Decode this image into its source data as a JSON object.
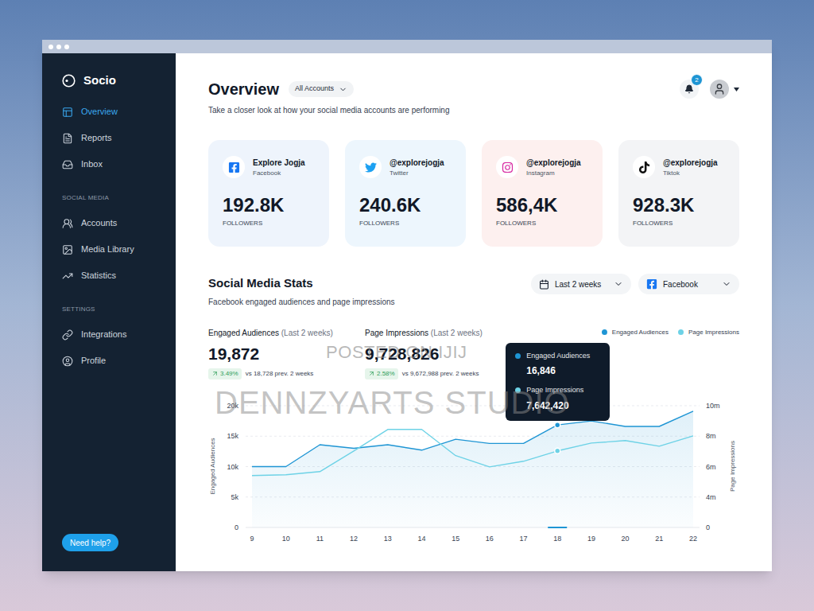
{
  "watermark": [
    "POSTED ON IJIJ",
    "DENNZYARTS STUDIO"
  ],
  "sidebar": {
    "brand": "Socio",
    "items": [
      {
        "label": "Overview",
        "selected": true
      },
      {
        "label": "Reports",
        "selected": false
      },
      {
        "label": "Inbox",
        "selected": false
      }
    ],
    "sections": [
      {
        "heading": "SOCIAL MEDIA",
        "items": [
          {
            "label": "Accounts",
            "selected": false
          },
          {
            "label": "Media Library",
            "selected": false
          },
          {
            "label": "Statistics",
            "selected": false
          }
        ]
      },
      {
        "heading": "SETTINGS",
        "items": [
          {
            "label": "Integrations",
            "selected": false
          },
          {
            "label": "Profile",
            "selected": false
          }
        ]
      }
    ],
    "help_button": "Need help?"
  },
  "header": {
    "title": "Overview",
    "account_filter": "All Accounts",
    "subtitle": "Take a closer look at how your social media accounts are performing",
    "notifications": "2"
  },
  "accounts": [
    {
      "name": "Explore Jogja",
      "platform": "Facebook",
      "followers": "192.8K",
      "unit": "FOLLOWERS",
      "color": "#eef4fc"
    },
    {
      "name": "@explorejogja",
      "platform": "Twitter",
      "followers": "240.6K",
      "unit": "FOLLOWERS",
      "color": "#edf6fd"
    },
    {
      "name": "@explorejogja",
      "platform": "Instagram",
      "followers": "586,4K",
      "unit": "FOLLOWERS",
      "color": "#fdf0ef"
    },
    {
      "name": "@explorejogja",
      "platform": "Tiktok",
      "followers": "928.3K",
      "unit": "FOLLOWERS",
      "color": "#f3f4f6"
    }
  ],
  "stats": {
    "title": "Social Media Stats",
    "subtitle": "Facebook engaged audiences and page impressions",
    "period": "Last 2 weeks",
    "platform": "Facebook",
    "metrics": [
      {
        "label": "Engaged Audiences",
        "period": "(Last 2 weeks)",
        "value": "19,872",
        "change": "3.49%",
        "comparison": "vs 18,728 prev. 2 weeks"
      },
      {
        "label": "Page Impressions",
        "period": "(Last 2 weeks)",
        "value": "9,728,826",
        "change": "2.58%",
        "comparison": "vs 9,672,988 prev. 2 weeks"
      }
    ]
  },
  "chart": {
    "series": [
      {
        "name": "Engaged Audiences",
        "color": "#1e95d4",
        "axis": "left",
        "values": [
          10000,
          10000,
          13600,
          13000,
          13600,
          12700,
          14500,
          13800,
          13800,
          16846,
          17500,
          16600,
          16600,
          19100
        ]
      },
      {
        "name": "Page Impressions",
        "color": "#6dd2e6",
        "axis": "right",
        "values": [
          5410000,
          5460000,
          5670000,
          7030000,
          8440000,
          8440000,
          6720000,
          5980000,
          6350000,
          7030000,
          7550000,
          7710000,
          7340000,
          8020000
        ]
      }
    ],
    "left_axis": {
      "title": "Engaged Audiences",
      "ticks": [
        {
          "label": "0",
          "value": 0
        },
        {
          "label": "5k",
          "value": 5000
        },
        {
          "label": "10k",
          "value": 10000
        },
        {
          "label": "15k",
          "value": 15000
        },
        {
          "label": "20k",
          "value": 20000
        }
      ]
    },
    "right_axis": {
      "title": "Page Impressions",
      "ticks": [
        {
          "label": "0",
          "value": 0
        },
        {
          "label": "4m",
          "value": 4000000
        },
        {
          "label": "6m",
          "value": 6000000
        },
        {
          "label": "8m",
          "value": 8000000
        },
        {
          "label": "10m",
          "value": 10000000
        }
      ]
    },
    "x_ticks": [
      {
        "label": "9",
        "selected": false
      },
      {
        "label": "10",
        "selected": false
      },
      {
        "label": "11",
        "selected": false
      },
      {
        "label": "12",
        "selected": false
      },
      {
        "label": "13",
        "selected": false
      },
      {
        "label": "14",
        "selected": false
      },
      {
        "label": "15",
        "selected": false
      },
      {
        "label": "16",
        "selected": false
      },
      {
        "label": "17",
        "selected": false
      },
      {
        "label": "18",
        "selected": true
      },
      {
        "label": "19",
        "selected": false
      },
      {
        "label": "20",
        "selected": false
      },
      {
        "label": "21",
        "selected": false
      },
      {
        "label": "22",
        "selected": false
      }
    ],
    "tooltip": [
      {
        "label": "Engaged Audiences",
        "value": "16,846"
      },
      {
        "label": "Page Impressions",
        "value": "7,642,420"
      }
    ]
  }
}
